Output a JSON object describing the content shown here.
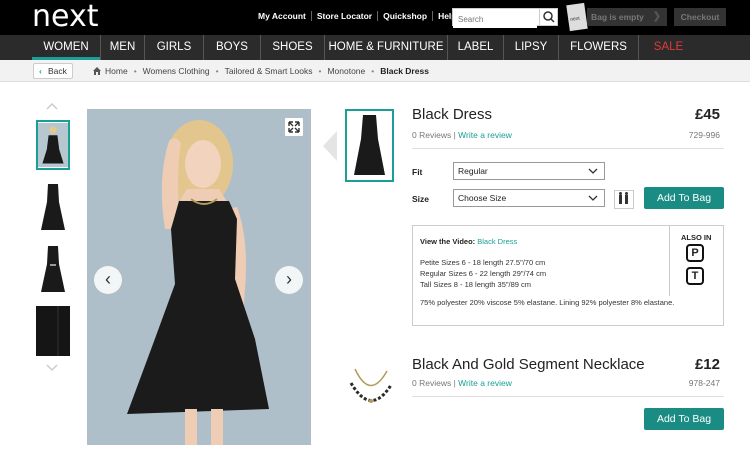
{
  "header": {
    "logo": "next",
    "links": [
      "My Account",
      "Store Locator",
      "Quickshop",
      "Help"
    ],
    "search_placeholder": "Search",
    "bag_label": "Bag is empty",
    "checkout_label": "Checkout"
  },
  "nav": {
    "items": [
      {
        "label": "WOMEN"
      },
      {
        "label": "MEN"
      },
      {
        "label": "GIRLS"
      },
      {
        "label": "BOYS"
      },
      {
        "label": "SHOES"
      },
      {
        "label": "HOME & FURNITURE"
      },
      {
        "label": "LABEL"
      },
      {
        "label": "LIPSY"
      },
      {
        "label": "FLOWERS"
      },
      {
        "label": "SALE"
      }
    ],
    "accent": "#1a9e96",
    "sale_color": "#e03a3a"
  },
  "breadcrumb": {
    "back_label": "Back",
    "items": [
      "Home",
      "Womens Clothing",
      "Tailored & Smart Looks",
      "Monotone"
    ],
    "current": "Black Dress"
  },
  "product": {
    "title": "Black Dress",
    "price": "£45",
    "reviews": "0 Reviews",
    "write_review": "Write a review",
    "code": "729-996",
    "fit_label": "Fit",
    "fit_value": "Regular",
    "size_label": "Size",
    "size_value": "Choose Size",
    "add_to_bag": "Add To Bag",
    "video_label": "View the Video:",
    "video_link": "Black Dress",
    "sizes": [
      "Petite Sizes 6 - 18 length 27.5\"/70 cm",
      "Regular Sizes 6 - 22 length 29\"/74 cm",
      "Tall Sizes 8 - 18 length 35\"/89 cm"
    ],
    "composition": "75% polyester 20% viscose 5% elastane. Lining 92% polyester 8% elastane.",
    "also_in": "ALSO IN",
    "also_in_options": [
      "P",
      "T"
    ]
  },
  "related": {
    "title": "Black And Gold Segment Necklace",
    "price": "£12",
    "reviews": "0 Reviews",
    "write_review": "Write a review",
    "code": "978-247",
    "add_to_bag": "Add To Bag"
  }
}
